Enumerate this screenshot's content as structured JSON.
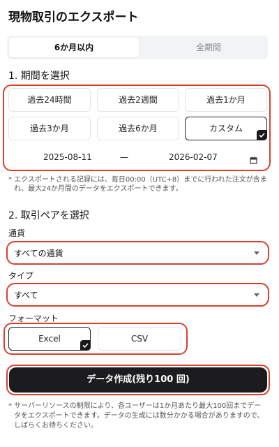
{
  "header": {
    "title": "現物取引のエクスポート"
  },
  "range_tabs": {
    "active": "6か月以内",
    "inactive": "全期間"
  },
  "period": {
    "heading": "1. 期間を選択",
    "options": [
      "過去24時間",
      "過去2週間",
      "過去1か月",
      "過去3か月",
      "過去6か月",
      "カスタム"
    ],
    "selected": "カスタム",
    "start_date": "2025-08-11",
    "separator": "—",
    "end_date": "2026-02-07",
    "note_line1": "* エクスポートされる記録には、毎日00:00（UTC+8）までに行われた注文が含ま",
    "note_line2": "れ、最大24か月間のデータをエクスポートできます。"
  },
  "pair": {
    "heading": "2. 取引ペアを選択",
    "currency_label": "通貨",
    "currency_value": "すべての通貨",
    "type_label": "タイプ",
    "type_value": "すべて",
    "format_label": "フォーマット",
    "format_options": [
      "Excel",
      "CSV"
    ],
    "format_selected": "Excel"
  },
  "submit": {
    "label": "データ作成(残り100 回)"
  },
  "footer_note": {
    "line1": "* サーバーリソースの制限により、各ユーザーは1か月あたり最大100回までデー",
    "line2": "タをエクスポートできます。データの生成には数分かかる場合がありますので、",
    "line3": "しばらくお待ちください。"
  },
  "colors": {
    "highlight": "#d9412e",
    "primary": "#1c1c1e"
  }
}
